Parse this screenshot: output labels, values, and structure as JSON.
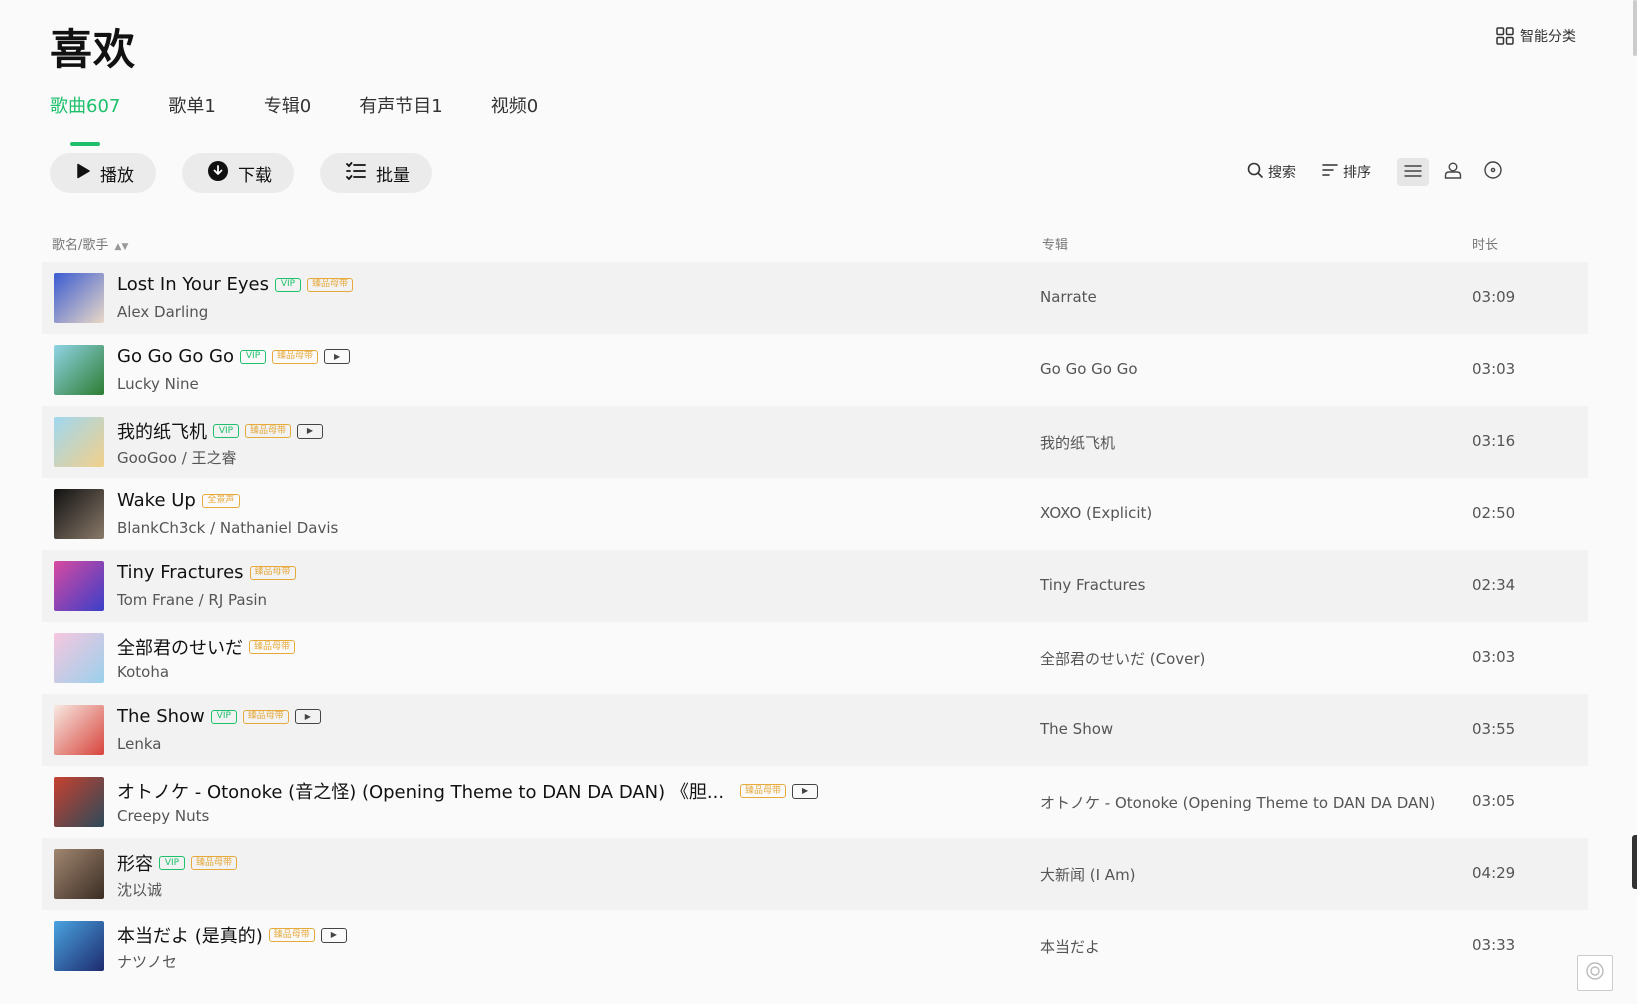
{
  "page": {
    "title": "喜欢",
    "smart_classify": "智能分类"
  },
  "tabs": [
    {
      "label": "歌曲607",
      "active": true
    },
    {
      "label": "歌单1",
      "active": false
    },
    {
      "label": "专辑0",
      "active": false
    },
    {
      "label": "有声节目1",
      "active": false
    },
    {
      "label": "视频0",
      "active": false
    }
  ],
  "actions": {
    "play": "播放",
    "download": "下载",
    "batch": "批量"
  },
  "tools": {
    "search": "搜索",
    "sort": "排序"
  },
  "columns": {
    "song_artist": "歌名/歌手",
    "album": "专辑",
    "duration": "时长"
  },
  "colors": {
    "accent": "#1ec06b",
    "hq_tag": "#e6a93c"
  },
  "songs": [
    {
      "title": "Lost In Your Eyes",
      "artist": "Alex Darling",
      "album": "Narrate",
      "duration": "03:09",
      "tags": [
        "VIP",
        "臻品母带"
      ],
      "cover": [
        "#3b5bd1",
        "#e9d9c7"
      ]
    },
    {
      "title": "Go Go Go Go",
      "artist": "Lucky Nine",
      "album": "Go Go Go Go",
      "duration": "03:03",
      "tags": [
        "VIP",
        "臻品母带",
        "MV"
      ],
      "cover": [
        "#8fd4e6",
        "#2e7d32"
      ]
    },
    {
      "title": "我的纸飞机",
      "artist": "GooGoo / 王之睿",
      "album": "我的纸飞机",
      "duration": "03:16",
      "tags": [
        "VIP",
        "臻品母带",
        "MV"
      ],
      "cover": [
        "#9fd7f0",
        "#f3d08a"
      ]
    },
    {
      "title": "Wake Up",
      "artist": "BlankCh3ck / Nathaniel Davis",
      "album": "XOXO (Explicit)",
      "duration": "02:50",
      "tags": [
        "全景声"
      ],
      "cover": [
        "#111111",
        "#8a7a6a"
      ]
    },
    {
      "title": "Tiny Fractures",
      "artist": "Tom Frane / RJ Pasin",
      "album": "Tiny Fractures",
      "duration": "02:34",
      "tags": [
        "臻品母带"
      ],
      "cover": [
        "#d84aa0",
        "#3a3fc8"
      ]
    },
    {
      "title": "全部君のせいだ",
      "artist": "Kotoha",
      "album": "全部君のせいだ (Cover)",
      "duration": "03:03",
      "tags": [
        "臻品母带"
      ],
      "cover": [
        "#f6c6de",
        "#9ad0ec"
      ]
    },
    {
      "title": "The Show",
      "artist": "Lenka",
      "album": "The Show",
      "duration": "03:55",
      "tags": [
        "VIP",
        "臻品母带",
        "MV"
      ],
      "cover": [
        "#f7e9e2",
        "#d7443c"
      ]
    },
    {
      "title": "オトノケ - Otonoke (音之怪) (Opening Theme to DAN DA DAN) 《胆...",
      "artist": "Creepy Nuts",
      "album": "オトノケ - Otonoke (Opening Theme to DAN DA DAN)",
      "duration": "03:05",
      "tags": [
        "臻品母带",
        "MV"
      ],
      "cover": [
        "#c8412f",
        "#2b4a5a"
      ]
    },
    {
      "title": "形容",
      "artist": "沈以诚",
      "album": "大新闻 (I Am)",
      "duration": "04:29",
      "tags": [
        "VIP",
        "臻品母带"
      ],
      "cover": [
        "#a08670",
        "#3b2d24"
      ]
    },
    {
      "title": "本当だよ (是真的)",
      "artist": "ナツノセ",
      "album": "本当だよ",
      "duration": "03:33",
      "tags": [
        "臻品母带",
        "MV"
      ],
      "cover": [
        "#4aa3e0",
        "#1d2b6e"
      ]
    }
  ]
}
